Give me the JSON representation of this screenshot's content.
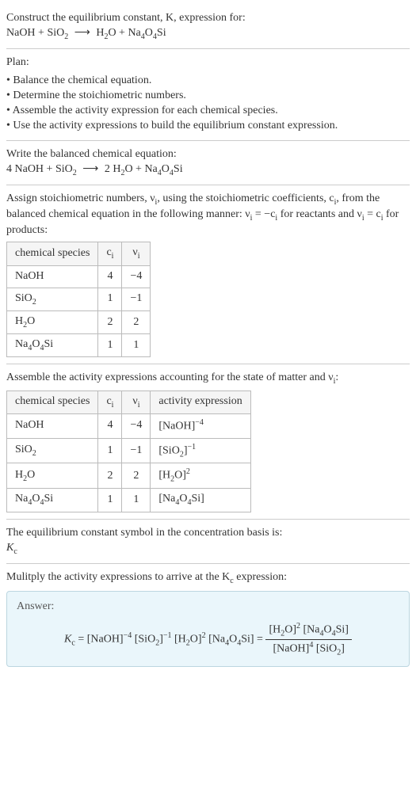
{
  "header": {
    "line1": "Construct the equilibrium constant, K, expression for:",
    "equation_lhs_1": "NaOH + SiO",
    "equation_lhs_1_sub": "2",
    "arrow": "⟶",
    "equation_rhs_1": "H",
    "equation_rhs_1_sub": "2",
    "equation_rhs_2": "O + Na",
    "equation_rhs_2_sub": "4",
    "equation_rhs_3": "O",
    "equation_rhs_3_sub": "4",
    "equation_rhs_4": "Si"
  },
  "plan": {
    "title": "Plan:",
    "items": [
      "Balance the chemical equation.",
      "Determine the stoichiometric numbers.",
      "Assemble the activity expression for each chemical species.",
      "Use the activity expressions to build the equilibrium constant expression."
    ]
  },
  "balanced": {
    "title": "Write the balanced chemical equation:",
    "c1": "4 NaOH + SiO",
    "c1_sub": "2",
    "arrow": "⟶",
    "c2": "2 H",
    "c2_sub": "2",
    "c3": "O + Na",
    "c3_sub": "4",
    "c4": "O",
    "c4_sub": "4",
    "c5": "Si"
  },
  "stoich": {
    "desc1": "Assign stoichiometric numbers, ν",
    "desc1_sub": "i",
    "desc2": ", using the stoichiometric coefficients, c",
    "desc2_sub": "i",
    "desc3": ", from the balanced chemical equation in the following manner: ν",
    "desc3_sub": "i",
    "desc4": " = −c",
    "desc4_sub": "i",
    "desc5": " for reactants and ν",
    "desc5_sub": "i",
    "desc6": " = c",
    "desc6_sub": "i",
    "desc7": " for products:",
    "table": {
      "h1": "chemical species",
      "h2": "c",
      "h2_sub": "i",
      "h3": "ν",
      "h3_sub": "i",
      "rows": [
        {
          "sp": "NaOH",
          "sub": "",
          "c": "4",
          "v": "−4"
        },
        {
          "sp": "SiO",
          "sub": "2",
          "c": "1",
          "v": "−1"
        },
        {
          "sp": "H",
          "sub": "2",
          "sp2": "O",
          "c": "2",
          "v": "2"
        },
        {
          "sp": "Na",
          "sub": "4",
          "sp2": "O",
          "sub2": "4",
          "sp3": "Si",
          "c": "1",
          "v": "1"
        }
      ]
    }
  },
  "activity": {
    "desc1": "Assemble the activity expressions accounting for the state of matter and ν",
    "desc1_sub": "i",
    "desc2": ":",
    "table": {
      "h1": "chemical species",
      "h2": "c",
      "h2_sub": "i",
      "h3": "ν",
      "h3_sub": "i",
      "h4": "activity expression",
      "rows": [
        {
          "sp": "NaOH",
          "c": "4",
          "v": "−4",
          "ae_open": "[NaOH]",
          "ae_sup": "−4"
        },
        {
          "sp": "SiO",
          "sub": "2",
          "c": "1",
          "v": "−1",
          "ae_open": "[SiO",
          "ae_sub": "2",
          "ae_close": "]",
          "ae_sup": "−1"
        },
        {
          "sp": "H",
          "sub": "2",
          "sp2": "O",
          "c": "2",
          "v": "2",
          "ae_open": "[H",
          "ae_sub": "2",
          "ae_close": "O]",
          "ae_sup": "2"
        },
        {
          "sp": "Na",
          "sub": "4",
          "sp2": "O",
          "sub2": "4",
          "sp3": "Si",
          "c": "1",
          "v": "1",
          "ae_open": "[Na",
          "ae_sub": "4",
          "ae_mid": "O",
          "ae_sub2": "4",
          "ae_close": "Si]"
        }
      ]
    }
  },
  "basis": {
    "line1": "The equilibrium constant symbol in the concentration basis is:",
    "sym": "K",
    "sym_sub": "c"
  },
  "mult": {
    "line1": "Mulitply the activity expressions to arrive at the K",
    "line1_sub": "c",
    "line2": " expression:"
  },
  "answer": {
    "label": "Answer:",
    "lhs": "K",
    "lhs_sub": "c",
    "eq": " = ",
    "t1": "[NaOH]",
    "t1_sup": "−4",
    "sp": " ",
    "t2a": "[SiO",
    "t2_sub": "2",
    "t2b": "]",
    "t2_sup": "−1",
    "t3a": "[H",
    "t3_sub": "2",
    "t3b": "O]",
    "t3_sup": "2",
    "t4a": "[Na",
    "t4_sub": "4",
    "t4b": "O",
    "t4_sub2": "4",
    "t4c": "Si]",
    "eq2": " = ",
    "num_a": "[H",
    "num_a_sub": "2",
    "num_b": "O]",
    "num_sup": "2",
    "num_c": "[Na",
    "num_c_sub": "4",
    "num_d": "O",
    "num_d_sub": "4",
    "num_e": "Si]",
    "den_a": "[NaOH]",
    "den_a_sup": "4",
    "den_b": "[SiO",
    "den_b_sub": "2",
    "den_c": "]"
  }
}
